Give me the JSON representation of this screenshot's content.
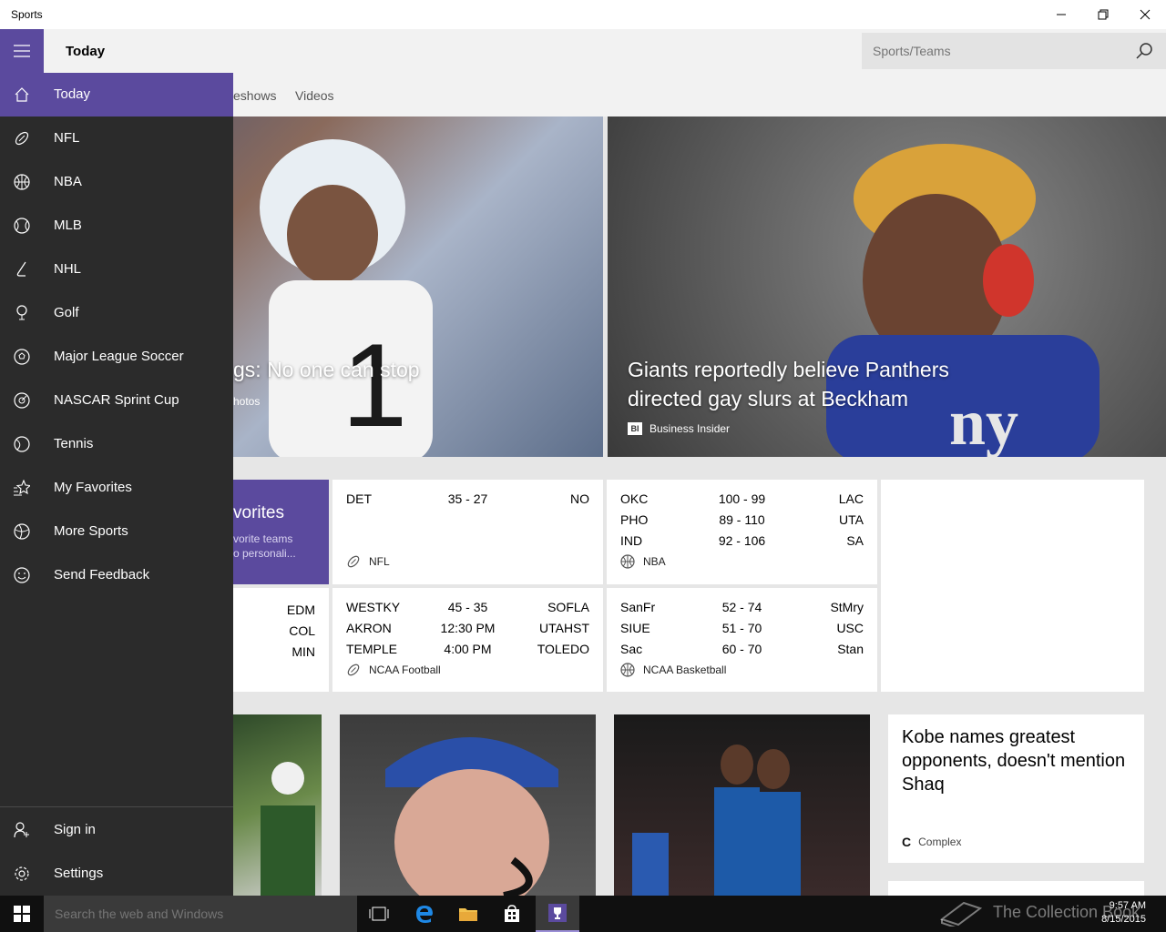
{
  "window": {
    "app_title": "Sports"
  },
  "header": {
    "page_title": "Today",
    "search_placeholder": "Sports/Teams"
  },
  "tabs": [
    {
      "label": "eshows"
    },
    {
      "label": "Videos"
    }
  ],
  "hero": [
    {
      "headline": "gs: No one can stop",
      "source": "hotos"
    },
    {
      "headline_line1": "Giants reportedly believe Panthers",
      "headline_line2": "directed gay slurs at Beckham",
      "source": "Business Insider",
      "source_logo": "BI"
    }
  ],
  "favorites_card": {
    "title": "vorites",
    "line1": "vorite teams",
    "line2": "o personali..."
  },
  "scores": {
    "nhl_partial": {
      "teams": [
        "EDM",
        "COL",
        "MIN"
      ]
    },
    "nfl": {
      "league": "NFL",
      "games": [
        {
          "away": "DET",
          "score": "35  -  27",
          "home": "NO"
        }
      ]
    },
    "nba": {
      "league": "NBA",
      "games": [
        {
          "away": "OKC",
          "score": "100  -  99",
          "home": "LAC"
        },
        {
          "away": "PHO",
          "score": "89  -  110",
          "home": "UTA"
        },
        {
          "away": "IND",
          "score": "92  -  106",
          "home": "SA"
        }
      ]
    },
    "ncaaf": {
      "league": "NCAA Football",
      "games": [
        {
          "away": "WESTKY",
          "score": "45  -  35",
          "home": "SOFLA"
        },
        {
          "away": "AKRON",
          "score": "12:30 PM",
          "home": "UTAHST"
        },
        {
          "away": "TEMPLE",
          "score": "4:00 PM",
          "home": "TOLEDO"
        }
      ]
    },
    "ncaab": {
      "league": "NCAA Basketball",
      "games": [
        {
          "away": "SanFr",
          "score": "52  -  74",
          "home": "StMry"
        },
        {
          "away": "SIUE",
          "score": "51  -  70",
          "home": "USC"
        },
        {
          "away": "Sac",
          "score": "60  -  70",
          "home": "Stan"
        }
      ]
    }
  },
  "news_card": {
    "headline": "Kobe names greatest opponents, doesn't mention Shaq",
    "source": "Complex",
    "source_logo": "C"
  },
  "nav": {
    "items": [
      {
        "label": "Today",
        "icon": "home-icon"
      },
      {
        "label": "NFL",
        "icon": "football-icon"
      },
      {
        "label": "NBA",
        "icon": "basketball-icon"
      },
      {
        "label": "MLB",
        "icon": "baseball-icon"
      },
      {
        "label": "NHL",
        "icon": "hockey-icon"
      },
      {
        "label": "Golf",
        "icon": "golf-icon"
      },
      {
        "label": "Major League Soccer",
        "icon": "soccer-icon"
      },
      {
        "label": "NASCAR Sprint Cup",
        "icon": "racing-icon"
      },
      {
        "label": "Tennis",
        "icon": "tennis-icon"
      },
      {
        "label": "My Favorites",
        "icon": "star-list-icon"
      },
      {
        "label": "More Sports",
        "icon": "more-sports-icon"
      },
      {
        "label": "Send Feedback",
        "icon": "smiley-icon"
      }
    ],
    "bottom": [
      {
        "label": "Sign in",
        "icon": "person-add-icon"
      },
      {
        "label": "Settings",
        "icon": "gear-icon"
      }
    ]
  },
  "taskbar": {
    "search_placeholder": "Search the web and Windows",
    "time": "9:57 AM",
    "date": "8/15/2015",
    "watermark": "The Collection Book"
  },
  "colors": {
    "accent": "#5b4a9e",
    "nav_bg": "#2b2b2b"
  }
}
